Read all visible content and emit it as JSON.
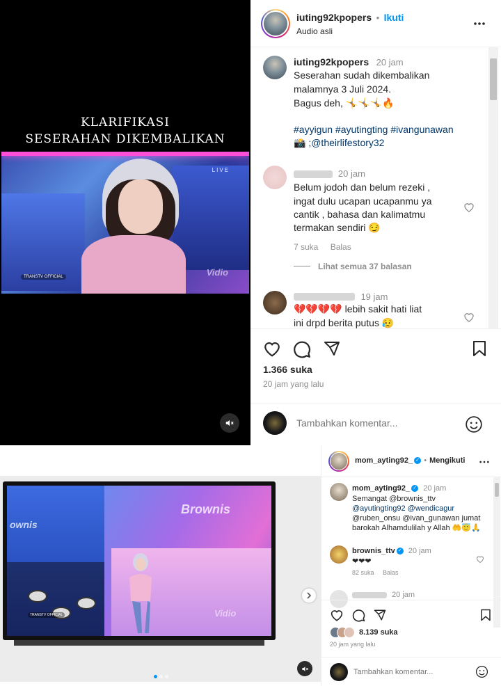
{
  "top_post": {
    "overlay_title_line1": "KLARIFIKASI",
    "overlay_title_line2": "SESERAHAN DIKEMBALIKAN",
    "video_tags": {
      "live": "LIVE",
      "vidio": "Vidio",
      "transtv": "TRANSTV OFFICIAL"
    },
    "header": {
      "username": "iuting92kpopers",
      "separator": "•",
      "follow_label": "Ikuti",
      "audio_label": "Audio asli",
      "more_icon": "more-dots-icon"
    },
    "caption": {
      "username": "iuting92kpopers",
      "time": "20 jam",
      "line1": "Seserahan sudah dikembalikan",
      "line2": "malamnya 3 Juli 2024.",
      "line3": "Bagus deh, 🤸🤸🤸🔥",
      "hashtags": "#ayyigun #ayutingting #ivangunawan",
      "credit": "📸 ;@theirlifestory32"
    },
    "comments": [
      {
        "time": "20 jam",
        "line1": "Belum jodoh dan belum rezeki ,",
        "line2": "ingat dulu ucapan ucapanmu ya",
        "line3": "cantik , bahasa dan kalimatmu",
        "line4": "termakan sendiri 😏",
        "likes": "7 suka",
        "reply": "Balas",
        "view_replies": "Lihat semua 37 balasan"
      },
      {
        "time": "19 jam",
        "line1": "💔💔💔💔 lebih sakit hati liat",
        "line2": "ini drpd berita putus 😥"
      }
    ],
    "likes_count": "1.366 suka",
    "posted_ago": "20 jam yang lalu",
    "add_comment_placeholder": "Tambahkan komentar..."
  },
  "bottom_post": {
    "header": {
      "username": "mom_ayting92_",
      "separator": "•",
      "following_label": "Mengikuti"
    },
    "caption": {
      "username": "mom_ayting92_",
      "time": "20 jam",
      "line1": "Semangat @brownis_ttv",
      "line2": "@ayutingting92 @wendicagur",
      "line3": "@ruben_onsu @ivan_gunawan jumat",
      "line4": "barokah Alhamdulilah y Allah 🤲😇🙏"
    },
    "comments": [
      {
        "username": "brownis_ttv",
        "time": "20 jam",
        "text": "❤❤❤",
        "likes": "82 suka",
        "reply": "Balas"
      },
      {
        "time": "20 jam"
      }
    ],
    "tv_logo": "Brownis",
    "tv_logo_side": "ownis",
    "likes_count": "8.139 suka",
    "posted_ago": "20 jam yang lalu",
    "add_comment_placeholder": "Tambahkan komentar..."
  },
  "colors": {
    "link_blue": "#0095f6",
    "hashtag_blue": "#00376b",
    "text_primary": "#262626",
    "text_secondary": "#8e8e8e",
    "divider": "#efefef"
  }
}
